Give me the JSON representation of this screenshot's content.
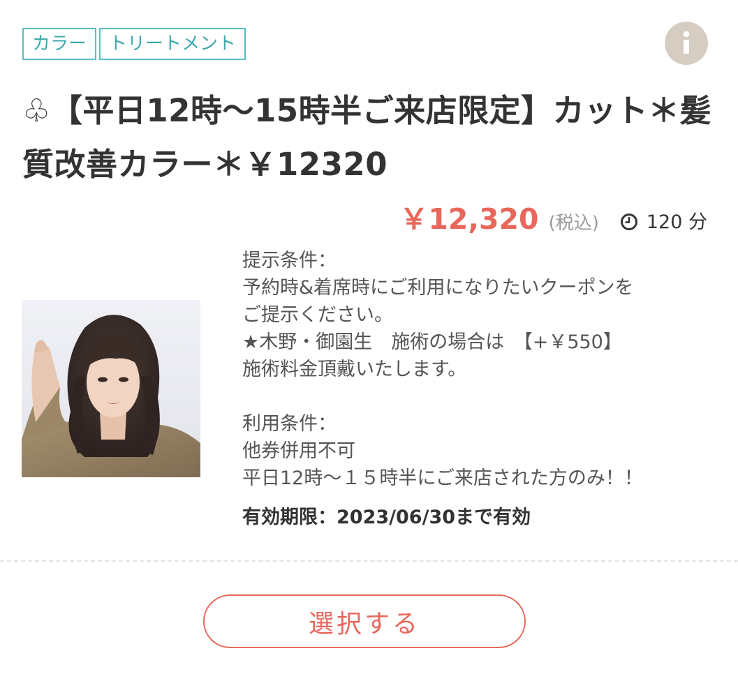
{
  "tags": [
    "カラー",
    "トリートメント"
  ],
  "title": "♧【平日12時〜15時半ご来店限定】カット＊髪質改善カラー＊￥12320",
  "price": "￥12,320",
  "tax_note": "(税込)",
  "duration": "120 分",
  "description": "提示条件：\n予約時&着席時にご利用になりたいクーポンを\nご提示ください。\n★木野・御園生　施術の場合は　【+￥550】\n施術料金頂戴いたします。\n\n利用条件：\n他券併用不可\n平日12時〜１５時半にご来店された方のみ！！",
  "validity": "有効期限：2023/06/30まで有効",
  "select_button_label": "選択する",
  "icons": {
    "info": "info-icon",
    "clock": "clock-icon"
  },
  "colors": {
    "tag_border": "#5bbfc0",
    "price": "#e8675c",
    "info_bg": "#d6cdc2",
    "button": "#e8675c"
  }
}
